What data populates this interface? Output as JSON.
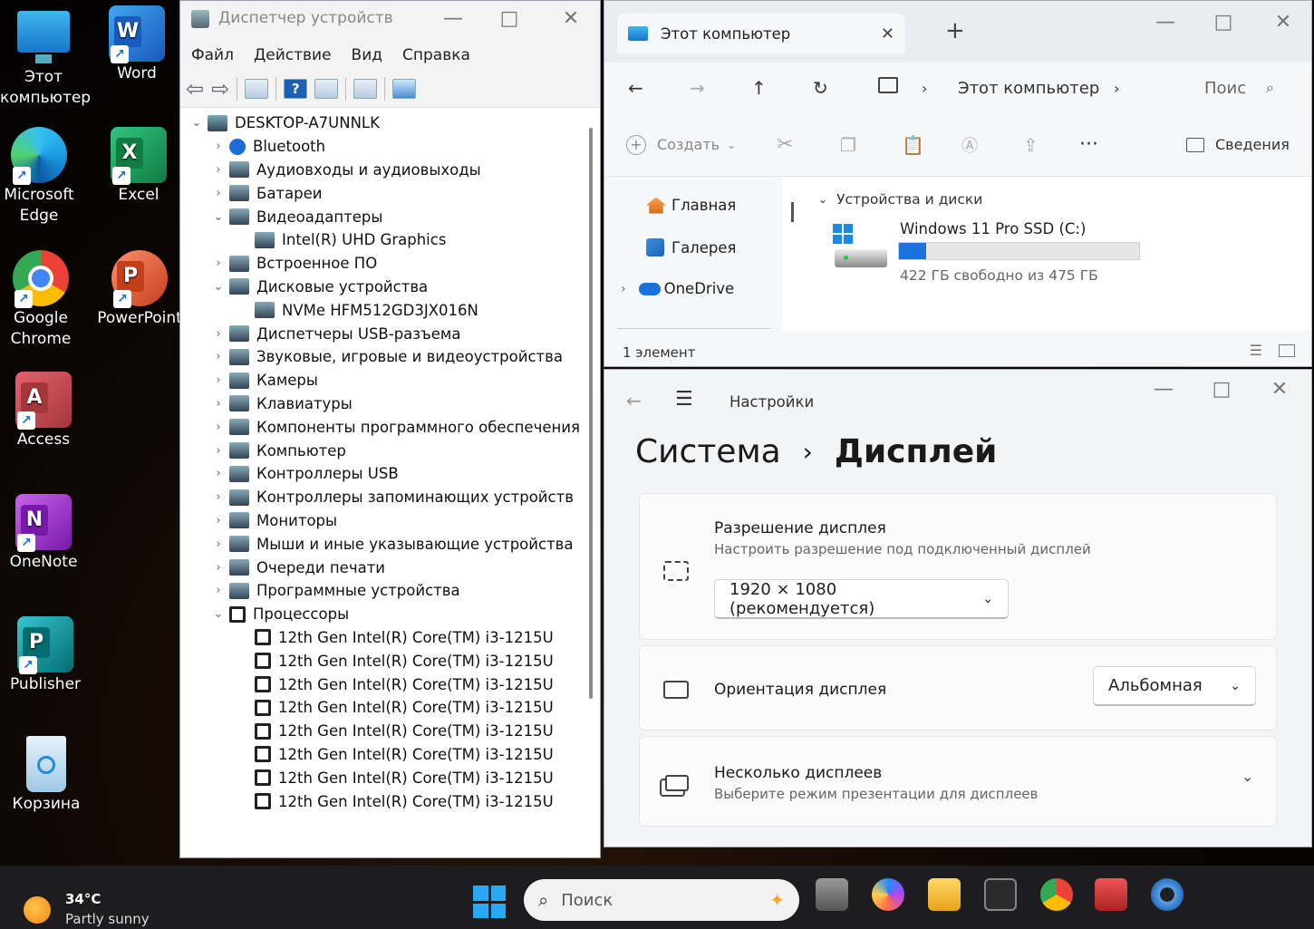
{
  "desktop": {
    "icons": [
      {
        "label": "Этот компьютер",
        "icon": "this-pc-icon"
      },
      {
        "label": "Word",
        "icon": "word-icon"
      },
      {
        "label": "Microsoft Edge",
        "icon": "edge-icon"
      },
      {
        "label": "Excel",
        "icon": "excel-icon"
      },
      {
        "label": "Google Chrome",
        "icon": "chrome-icon"
      },
      {
        "label": "PowerPoint",
        "icon": "powerpoint-icon"
      },
      {
        "label": "Access",
        "icon": "access-icon"
      },
      {
        "label": "OneNote",
        "icon": "onenote-icon"
      },
      {
        "label": "Publisher",
        "icon": "publisher-icon"
      },
      {
        "label": "Корзина",
        "icon": "recycle-bin-icon"
      }
    ]
  },
  "devmgr": {
    "title": "Диспетчер устройств",
    "menu": [
      "Файл",
      "Действие",
      "Вид",
      "Справка"
    ],
    "root": "DESKTOP-A7UNNLK",
    "tree": [
      {
        "label": "Bluetooth",
        "expanded": false,
        "level": 1,
        "icon": "bluetooth-icon"
      },
      {
        "label": "Аудиовходы и аудиовыходы",
        "expanded": false,
        "level": 1,
        "icon": "speaker-icon"
      },
      {
        "label": "Батареи",
        "expanded": false,
        "level": 1,
        "icon": "battery-icon"
      },
      {
        "label": "Видеоадаптеры",
        "expanded": true,
        "level": 1,
        "icon": "display-adapter-icon"
      },
      {
        "label": "Intel(R) UHD Graphics",
        "level": 2,
        "icon": "display-adapter-icon"
      },
      {
        "label": "Встроенное ПО",
        "expanded": false,
        "level": 1,
        "icon": "firmware-icon"
      },
      {
        "label": "Дисковые устройства",
        "expanded": true,
        "level": 1,
        "icon": "disk-icon"
      },
      {
        "label": "NVMe HFM512GD3JX016N",
        "level": 2,
        "icon": "disk-icon"
      },
      {
        "label": "Диспетчеры USB-разъема",
        "expanded": false,
        "level": 1,
        "icon": "usb-icon"
      },
      {
        "label": "Звуковые, игровые и видеоустройства",
        "expanded": false,
        "level": 1,
        "icon": "speaker-icon"
      },
      {
        "label": "Камеры",
        "expanded": false,
        "level": 1,
        "icon": "camera-icon"
      },
      {
        "label": "Клавиатуры",
        "expanded": false,
        "level": 1,
        "icon": "keyboard-icon"
      },
      {
        "label": "Компоненты программного обеспечения",
        "expanded": false,
        "level": 1,
        "icon": "software-component-icon"
      },
      {
        "label": "Компьютер",
        "expanded": false,
        "level": 1,
        "icon": "computer-icon"
      },
      {
        "label": "Контроллеры USB",
        "expanded": false,
        "level": 1,
        "icon": "usb-icon"
      },
      {
        "label": "Контроллеры запоминающих устройств",
        "expanded": false,
        "level": 1,
        "icon": "storage-controller-icon"
      },
      {
        "label": "Мониторы",
        "expanded": false,
        "level": 1,
        "icon": "monitor-icon"
      },
      {
        "label": "Мыши и иные указывающие устройства",
        "expanded": false,
        "level": 1,
        "icon": "mouse-icon"
      },
      {
        "label": "Очереди печати",
        "expanded": false,
        "level": 1,
        "icon": "printer-icon"
      },
      {
        "label": "Программные устройства",
        "expanded": false,
        "level": 1,
        "icon": "software-device-icon"
      },
      {
        "label": "Процессоры",
        "expanded": true,
        "level": 1,
        "icon": "processor-icon"
      },
      {
        "label": "12th Gen Intel(R) Core(TM) i3-1215U",
        "level": 2,
        "icon": "processor-icon"
      },
      {
        "label": "12th Gen Intel(R) Core(TM) i3-1215U",
        "level": 2,
        "icon": "processor-icon"
      },
      {
        "label": "12th Gen Intel(R) Core(TM) i3-1215U",
        "level": 2,
        "icon": "processor-icon"
      },
      {
        "label": "12th Gen Intel(R) Core(TM) i3-1215U",
        "level": 2,
        "icon": "processor-icon"
      },
      {
        "label": "12th Gen Intel(R) Core(TM) i3-1215U",
        "level": 2,
        "icon": "processor-icon"
      },
      {
        "label": "12th Gen Intel(R) Core(TM) i3-1215U",
        "level": 2,
        "icon": "processor-icon"
      },
      {
        "label": "12th Gen Intel(R) Core(TM) i3-1215U",
        "level": 2,
        "icon": "processor-icon"
      },
      {
        "label": "12th Gen Intel(R) Core(TM) i3-1215U",
        "level": 2,
        "icon": "processor-icon"
      }
    ]
  },
  "explorer": {
    "tab_title": "Этот компьютер",
    "breadcrumb": "Этот компьютер",
    "search_placeholder": "Поис",
    "create_label": "Создать",
    "details_label": "Сведения",
    "nav_items": [
      {
        "label": "Главная",
        "icon": "home-icon"
      },
      {
        "label": "Галерея",
        "icon": "gallery-icon"
      },
      {
        "label": "OneDrive",
        "icon": "onedrive-icon"
      }
    ],
    "section_label": "Устройства и диски",
    "drive": {
      "name": "Windows 11 Pro SSD (C:)",
      "free_text": "422 ГБ свободно из 475 ГБ",
      "used_fraction": 0.112
    },
    "status": "1 элемент"
  },
  "settings": {
    "app_title": "Настройки",
    "breadcrumb_parent": "Система",
    "breadcrumb_current": "Дисплей",
    "resolution": {
      "title": "Разрешение дисплея",
      "subtitle": "Настроить разрешение под подключенный дисплей",
      "value": "1920 × 1080 (рекомендуется)"
    },
    "orientation": {
      "title": "Ориентация дисплея",
      "value": "Альбомная"
    },
    "multiple": {
      "title": "Несколько дисплеев",
      "subtitle": "Выберите режим презентации для дисплеев"
    }
  },
  "taskbar": {
    "weather_temp": "34°C",
    "weather_desc": "Partly sunny",
    "search_placeholder": "Поиск"
  },
  "colors": {
    "accent": "#0067c0",
    "drive_bar": "#1a73d9"
  }
}
